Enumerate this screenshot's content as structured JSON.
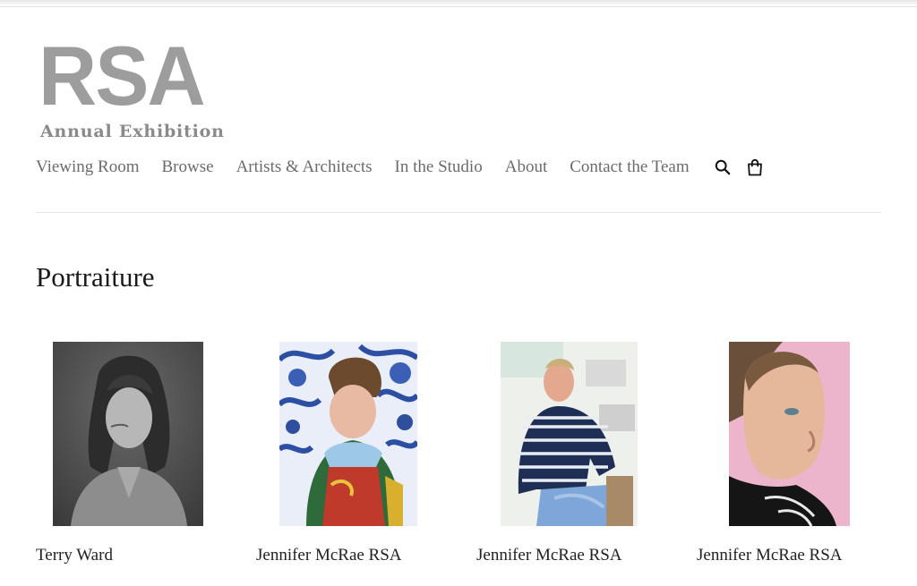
{
  "logo": {
    "mark": "RSA",
    "subtitle": "Annual Exhibition"
  },
  "nav": {
    "items": [
      "Viewing Room",
      "Browse",
      "Artists & Architects",
      "In the Studio",
      "About",
      "Contact the Team"
    ],
    "icons": [
      "search-icon",
      "bag-icon"
    ]
  },
  "page": {
    "title": "Portraiture"
  },
  "artworks": [
    {
      "artist": "Terry Ward",
      "image": "grayscale portrait of a man with long curly hair"
    },
    {
      "artist": "Jennifer McRae RSA",
      "image": "watercolour of a young man in a red and green hoodie against blue dragon pattern"
    },
    {
      "artist": "Jennifer McRae RSA",
      "image": "painting of a seated man in a navy striped jumper"
    },
    {
      "artist": "Jennifer McRae RSA",
      "image": "close portrait of a young man against a pink background"
    }
  ],
  "colors": {
    "logo": "#9d9d9d",
    "nav_text": "#6b6b6b",
    "title": "#1a1a1a"
  }
}
